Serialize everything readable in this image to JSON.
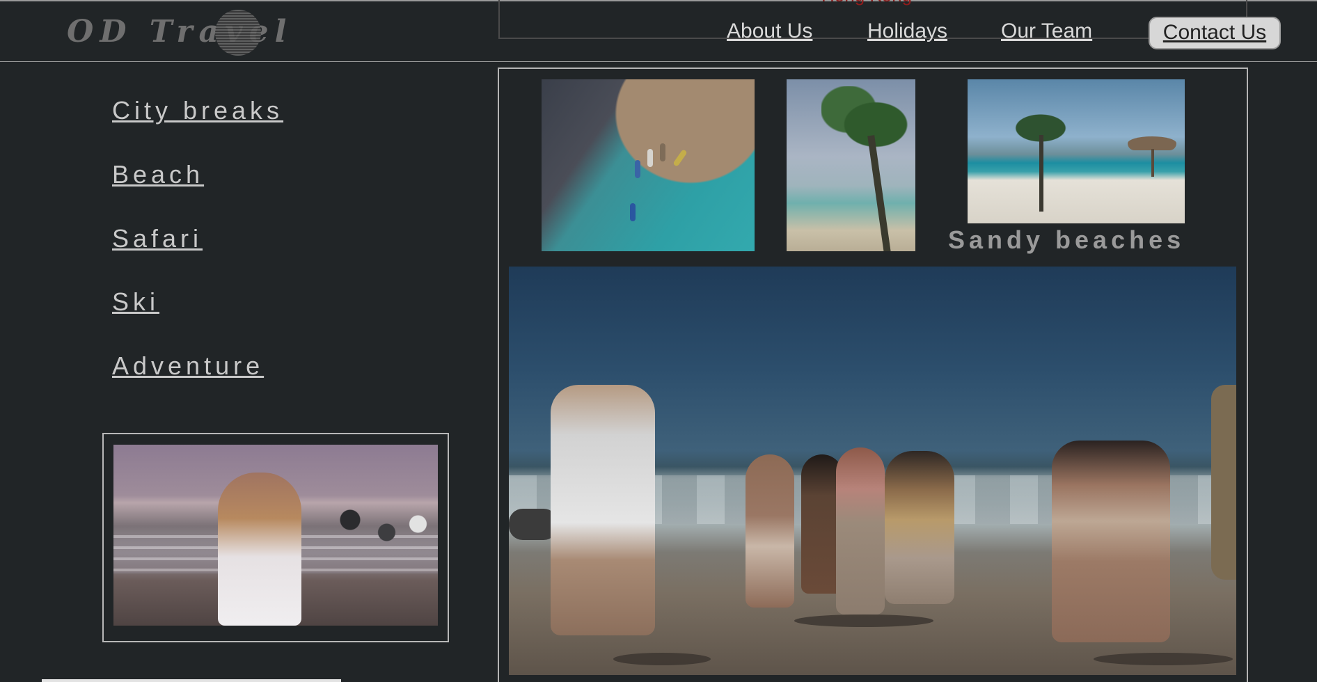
{
  "header": {
    "logo_text": "OD Travel",
    "hidden_banner_text": "Hong Kong",
    "nav": {
      "about": "About Us",
      "holidays": "Holidays",
      "team": "Our Team",
      "contact": "Contact Us"
    }
  },
  "sidebar": {
    "items": [
      "City breaks",
      "Beach",
      "Safari",
      "Ski",
      "Adventure"
    ]
  },
  "main": {
    "caption": "Sandy beaches"
  }
}
